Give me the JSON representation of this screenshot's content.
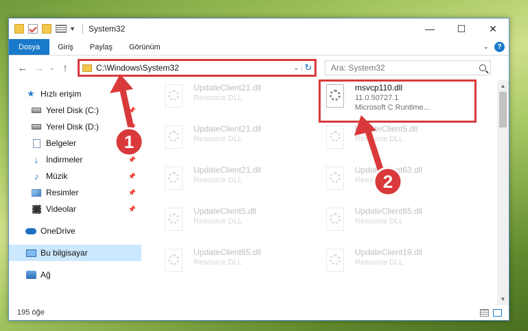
{
  "window": {
    "title": "System32",
    "controls": {
      "minimize": "—",
      "maximize": "☐",
      "close": "✕"
    }
  },
  "ribbon": {
    "tabs": [
      "Dosya",
      "Giriş",
      "Paylaş",
      "Görünüm"
    ],
    "expand": "⌄",
    "help": "?"
  },
  "nav": {
    "back": "←",
    "forward": "→",
    "recent": "⌄",
    "up": "↑",
    "address": "C:\\Windows\\System32",
    "address_dropdown": "⌄",
    "refresh": "↻",
    "search_placeholder": "Ara: System32"
  },
  "sidebar": {
    "items": [
      {
        "label": "Hızlı erişim",
        "icon": "star-icon",
        "pinned": false
      },
      {
        "label": "Yerel Disk (C:)",
        "icon": "drive-icon",
        "pinned": true
      },
      {
        "label": "Yerel Disk (D:)",
        "icon": "drive-icon",
        "pinned": true
      },
      {
        "label": "Belgeler",
        "icon": "document-icon",
        "pinned": true
      },
      {
        "label": "İndirmeler",
        "icon": "download-icon",
        "pinned": true
      },
      {
        "label": "Müzik",
        "icon": "music-icon",
        "pinned": true
      },
      {
        "label": "Resimler",
        "icon": "pictures-icon",
        "pinned": true
      },
      {
        "label": "Videolar",
        "icon": "video-icon",
        "pinned": true
      },
      {
        "label": "OneDrive",
        "icon": "cloud-icon",
        "pinned": false
      },
      {
        "label": "Bu bilgisayar",
        "icon": "computer-icon",
        "pinned": false
      },
      {
        "label": "Ağ",
        "icon": "network-icon",
        "pinned": false
      }
    ],
    "pin_glyph": "📌"
  },
  "files": {
    "left": [
      {
        "name": "UpdateClient21.dll",
        "desc": "Resource DLL"
      },
      {
        "name": "UpdateClient21.dll",
        "desc": "Resource DLL"
      },
      {
        "name": "UpdateClient21.dll",
        "desc": "Resource DLL"
      },
      {
        "name": "UpdateClient5.dll",
        "desc": "Resource DLL"
      },
      {
        "name": "UpdateClient65.dll",
        "desc": "Resource DLL"
      }
    ],
    "right": [
      {
        "name": "msvcp110.dll",
        "desc": "11.0.50727.1",
        "desc2": "Microsoft C Runtime..."
      },
      {
        "name": "UpdateClient5.dll",
        "desc": "Resource DLL"
      },
      {
        "name": "UpdateClient63.dll",
        "desc": "Resource DLL"
      },
      {
        "name": "UpdateClient65.dll",
        "desc": "Resource DLL"
      },
      {
        "name": "UpdateClient19.dll",
        "desc": "Resource DLL"
      }
    ]
  },
  "status": {
    "count": "195 öğe"
  },
  "annotations": {
    "badge1": "1",
    "badge2": "2",
    "color": "#d9393b"
  }
}
